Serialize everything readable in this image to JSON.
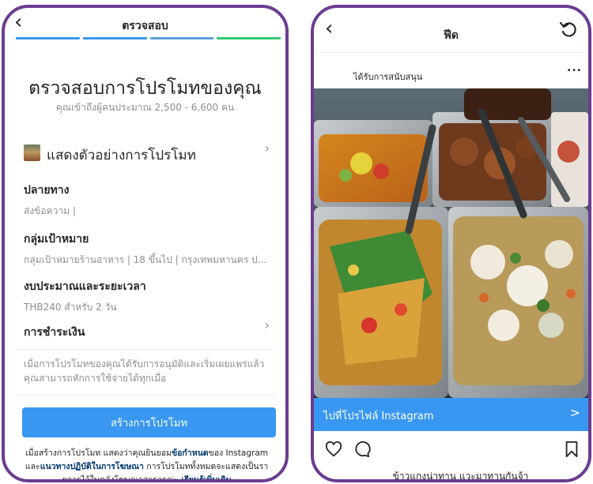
{
  "review": {
    "back_icon": "chevron-left-icon",
    "title": "ตรวจสอบ",
    "progress_colors": [
      "#3897f0",
      "#3897f0",
      "#6fa8dc",
      "#2ecc71"
    ],
    "headline": "ตรวจสอบการโปรโมทของคุณ",
    "reach": "คุณเข้าถึงผู้คนประมาณ 2,500 - 6,600 คน",
    "preview_label": "แสดงตัวอย่างการโปรโมท",
    "destination": {
      "title": "ปลายทาง",
      "value": "ส่งข้อความ |"
    },
    "audience": {
      "title": "กลุ่มเป้าหมาย",
      "value": "กลุ่มเป้าหมายร้านอาหาร | 18 ขึ้นไป | กรุงเทพมหานคร ป..."
    },
    "budget": {
      "title": "งบประมาณและระยะเวลา",
      "value": "THB240 สำหรับ 2 วัน"
    },
    "payment": {
      "title": "การชำระเงิน"
    },
    "info": "เมื่อการโปรโมทของคุณได้รับการอนุมัติและเริ่มเผยแพร่แล้ว คุณสามารถหักการใช้จ่ายได้ทุกเมื่อ",
    "create_button": "สร้างการโปรโมท",
    "terms": {
      "part1": "เมื่อสร้างการโปรโมท แสดงว่าคุณยินยอม",
      "link1": "ข้อกำหนด",
      "part2": "ของ Instagram",
      "part3": "และ",
      "link2": "แนวทางปฏิบัติในการโฆษณา",
      "part4": " การโปรโมททั้งหมดจะแสดงเป็นรา",
      "part5": "ยการไว้ในคลังโฆษณาสาธารณะ ",
      "link3": "เรียนรู้เพิ่มเติม"
    },
    "accent": "#3897f0"
  },
  "feed": {
    "back_icon": "chevron-left-icon",
    "title": "ฟีด",
    "refresh_icon": "refresh-icon",
    "sponsored": "ได้รับการสนับสนุน",
    "more_icon": "more-dots-icon",
    "more": "...",
    "image": "food-tray-photo",
    "cta": "ไปที่โปรไฟล์ Instagram",
    "cta_chevron": ">",
    "like_icon": "heart-icon",
    "comment_icon": "comment-icon",
    "save_icon": "bookmark-icon",
    "caption": "ข้าวแกงน่าทาน แวะมาทานกันจ้า"
  },
  "frame_color": "#6b3c91"
}
